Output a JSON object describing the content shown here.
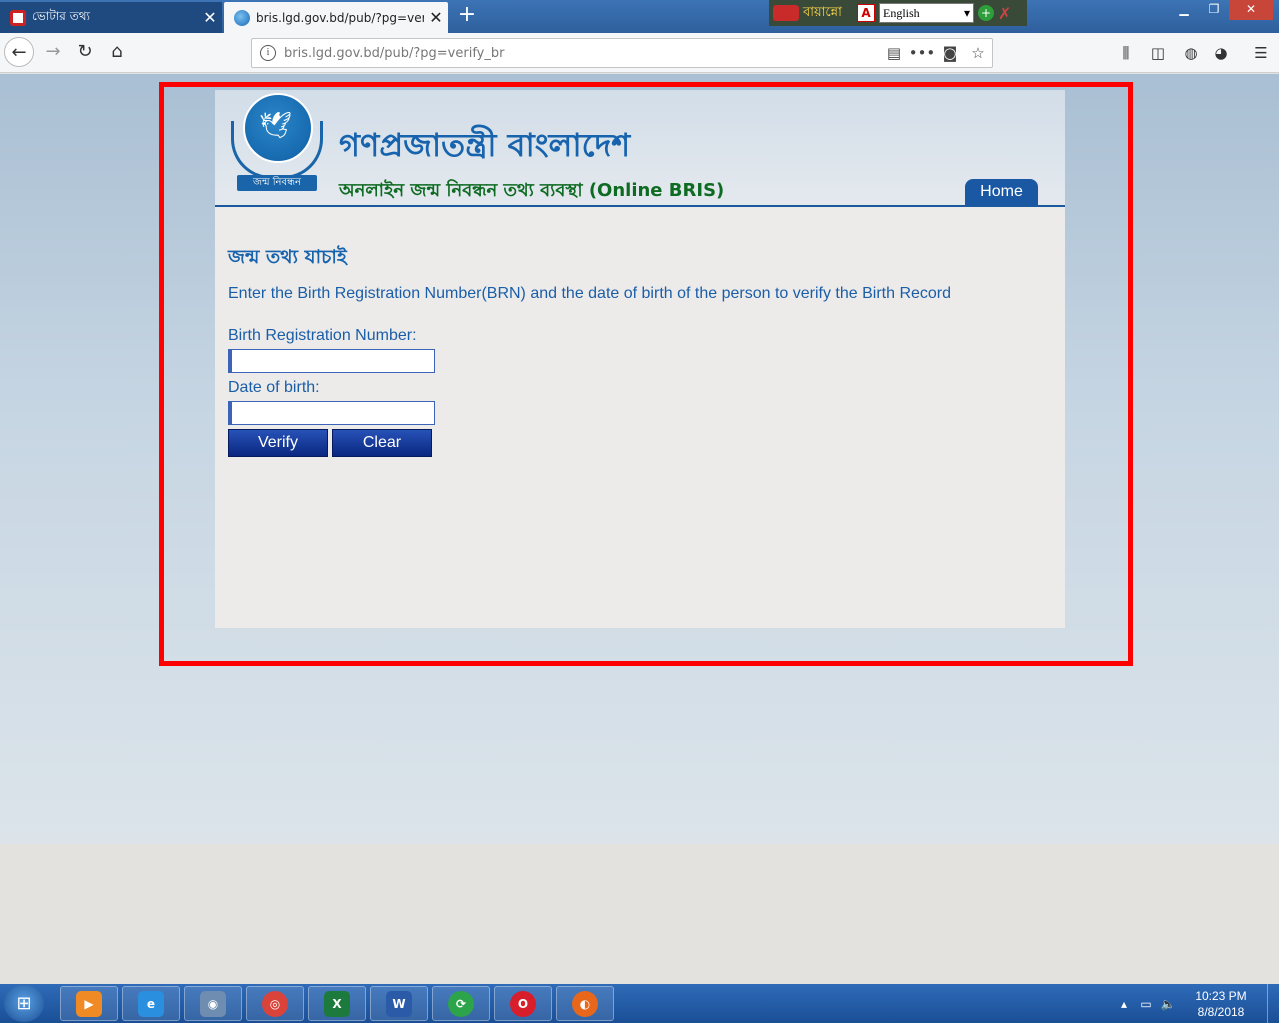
{
  "browser": {
    "tabs": [
      {
        "title": "ভোটার তথ্য",
        "active": false
      },
      {
        "title": "bris.lgd.gov.bd/pub/?pg=verify",
        "active": true
      }
    ],
    "new_tab": "+",
    "url": "bris.lgd.gov.bd/pub/?pg=verify_br",
    "ime": {
      "app_name": "বায়ান্নো",
      "language": "English"
    }
  },
  "page": {
    "header": {
      "title_bn": "গণপ্রজাতন্ত্রী বাংলাদেশ",
      "subtitle": "অনলাইন জন্ম নিবন্ধন তথ্য ব্যবস্থা (Online BRIS)",
      "logo_banner": "জন্ম নিবন্ধন",
      "home_tab": "Home"
    },
    "heading": "জন্ম তথ্য যাচাই",
    "instruction": "Enter the Birth Registration Number(BRN) and the date of birth of the person to verify the Birth Record",
    "form": {
      "brn_label": "Birth Registration Number:",
      "brn_value": "",
      "dob_label": "Date of birth:",
      "dob_value": "",
      "verify_button": "Verify",
      "clear_button": "Clear"
    }
  },
  "taskbar": {
    "clock_time": "10:23 PM",
    "clock_date": "8/8/2018"
  },
  "colors": {
    "accent_blue": "#1763ad",
    "subtitle_green": "#0e6b22",
    "button_blue": "#0a2780",
    "highlight_red": "#ff0000"
  }
}
